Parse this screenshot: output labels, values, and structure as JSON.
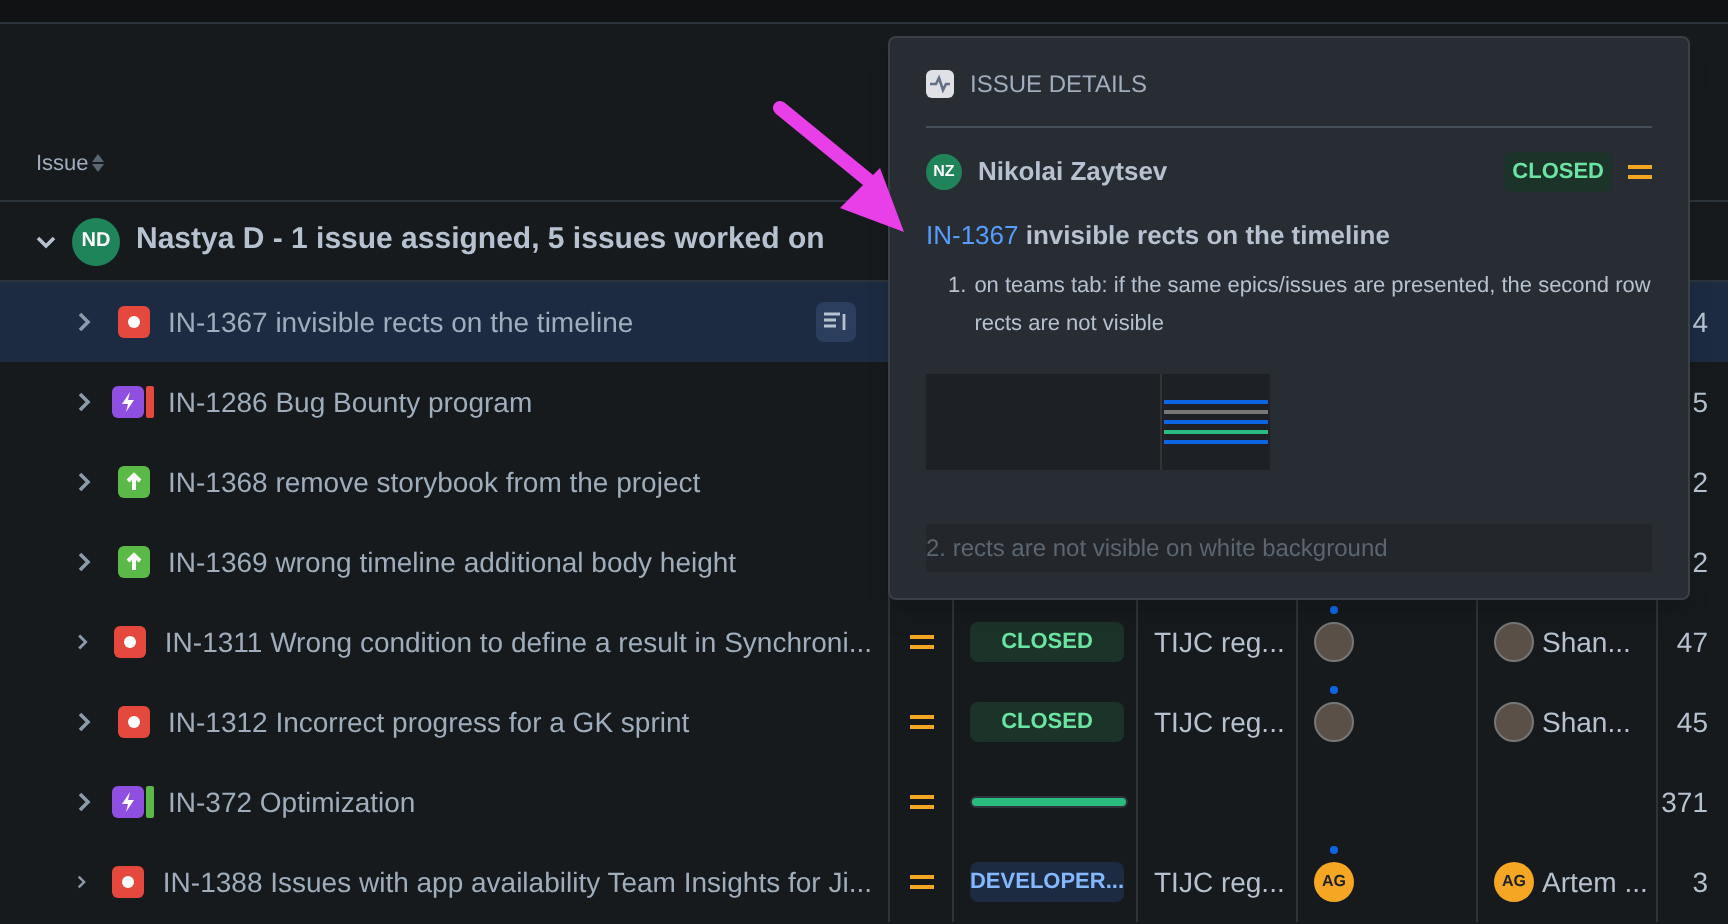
{
  "table": {
    "columns": [
      {
        "label": "Issue",
        "sortable": true
      }
    ],
    "group": {
      "initials": "ND",
      "title": "Nastya D - 1 issue assigned, 5 issues worked on",
      "expanded": true
    },
    "rows": [
      {
        "kind": "bug",
        "title": "IN-1367 invisible rects on the timeline",
        "selected": true,
        "hovered": true,
        "number": "4"
      },
      {
        "kind": "epic",
        "color": "#e5483d",
        "title": "IN-1286 Bug Bounty program",
        "selected": false,
        "hovered": false,
        "number": "5"
      },
      {
        "kind": "story",
        "title": "IN-1368 remove storybook from the project",
        "selected": false,
        "hovered": false,
        "number": "2"
      },
      {
        "kind": "story",
        "title": "IN-1369 wrong timeline additional body height",
        "selected": false,
        "hovered": false,
        "number": "2"
      },
      {
        "kind": "bug",
        "title": "IN-1311 Wrong condition to define a result in Synchroni...",
        "selected": false,
        "hovered": false,
        "priority": {
          "kind": "medium"
        },
        "status": {
          "kind": "closed",
          "label": "CLOSED"
        },
        "column_4": "TIJC reg...",
        "reporter": {
          "kind": "photo"
        },
        "assignee": {
          "avatar": {
            "kind": "photo"
          },
          "name": "Shan..."
        },
        "number": "47"
      },
      {
        "kind": "bug",
        "title": "IN-1312 Incorrect progress for a GK sprint",
        "selected": false,
        "hovered": false,
        "priority": {
          "kind": "medium"
        },
        "status": {
          "kind": "closed",
          "label": "CLOSED"
        },
        "column_4": "TIJC reg...",
        "reporter": {
          "kind": "photo"
        },
        "assignee": {
          "avatar": {
            "kind": "photo"
          },
          "name": "Shan..."
        },
        "number": "45"
      },
      {
        "kind": "epic",
        "color": "#5bb947",
        "title": "IN-372 Optimization",
        "selected": false,
        "hovered": false,
        "priority": {
          "kind": "medium"
        },
        "status": {
          "kind": "bar",
          "level": 1
        },
        "number": "371"
      },
      {
        "kind": "bug",
        "title": "IN-1388 Issues with app availability Team Insights for Ji...",
        "selected": false,
        "hovered": false,
        "priority": {
          "kind": "medium"
        },
        "status": {
          "kind": "developer",
          "label": "DEVELOPER..."
        },
        "column_4": "TIJC reg...",
        "reporter": {
          "kind": "initials",
          "text": "AG"
        },
        "assignee": {
          "avatar": {
            "kind": "initials",
            "text": "AG"
          },
          "name": "Artem ..."
        },
        "number": "3"
      }
    ]
  },
  "popover": {
    "title": "ISSUE DETAILS",
    "user": {
      "initials": "NZ",
      "name": "Nikolai Zaytsev"
    },
    "status": {
      "kind": "closed",
      "label": "CLOSED"
    },
    "priority": {
      "kind": "medium"
    },
    "issue_key": "IN-1367",
    "issue_title": "invisible rects on the timeline",
    "items": [
      {
        "number": "1.",
        "text": "on teams tab: if the same epics/issues are presented, the second row rects are not visible"
      }
    ],
    "faded_text": "2. rects are not visible on white background"
  }
}
